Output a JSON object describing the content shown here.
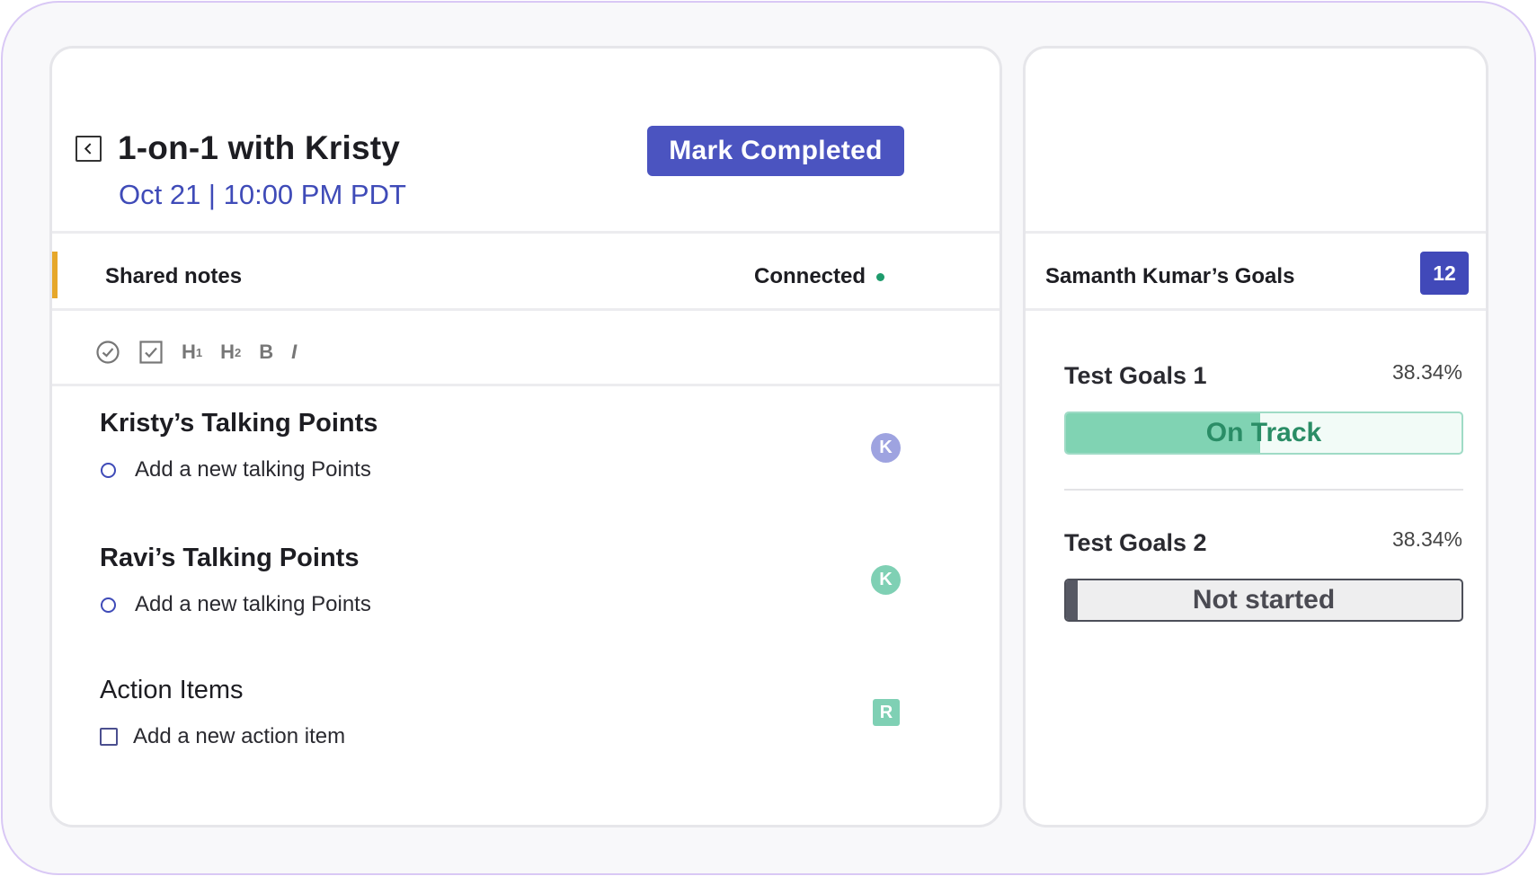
{
  "meeting": {
    "title": "1-on-1 with Kristy",
    "datetime": "Oct 21 | 10:00 PM PDT",
    "mark_completed_label": "Mark Completed",
    "back_icon": "chevron-left-icon"
  },
  "notes": {
    "label": "Shared notes",
    "status": "Connected",
    "status_color": "#1e9b6c",
    "accent_color": "#e6a72a"
  },
  "toolbar": {
    "tools": [
      "check-circle-icon",
      "checkbox-icon",
      "heading-1-icon",
      "heading-2-icon",
      "bold-icon",
      "italic-icon"
    ],
    "h1_label": "H",
    "h2_label": "H",
    "bold_label": "B",
    "italic_label": "I"
  },
  "sections": [
    {
      "title": "Kristy’s Talking Points",
      "add_label": "Add a new talking Points",
      "avatar": "K",
      "avatar_color": "#9ea3e0"
    },
    {
      "title": "Ravi’s Talking Points",
      "add_label": "Add a new talking Points",
      "avatar": "K",
      "avatar_color": "#7fd0b4"
    },
    {
      "title": "Action Items",
      "add_label": "Add a new action item",
      "avatar": "R",
      "avatar_color": "#7fd0b4"
    }
  ],
  "goals": {
    "title": "Samanth Kumar’s Goals",
    "count": "12",
    "items": [
      {
        "name": "Test Goals 1",
        "percent": "38.34%",
        "status": "On Track",
        "progress": 0.49
      },
      {
        "name": "Test Goals 2",
        "percent": "38.34%",
        "status": "Not started",
        "progress": 0.03
      }
    ]
  },
  "colors": {
    "primary": "#4b54c0",
    "on_track_fill": "#80d3b3",
    "not_started_fill": "#565863",
    "frame_border": "#d9c8f5"
  }
}
